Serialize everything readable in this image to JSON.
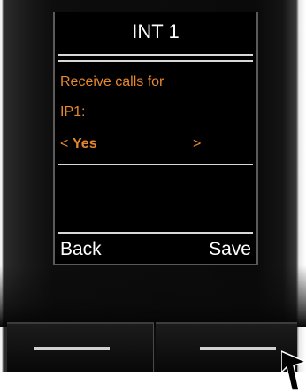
{
  "display": {
    "title": "INT 1",
    "lines": [
      "Receive calls for",
      "IP1:"
    ],
    "selector": {
      "left_arrow": "<",
      "value": "Yes",
      "right_arrow": ">"
    },
    "softkeys": {
      "left": "Back",
      "right": "Save"
    }
  },
  "colors": {
    "highlight": "#e8882c",
    "screen_bg": "#000000",
    "text": "#ffffff"
  },
  "icons": {
    "pointer": "arrow-pointer-icon"
  }
}
